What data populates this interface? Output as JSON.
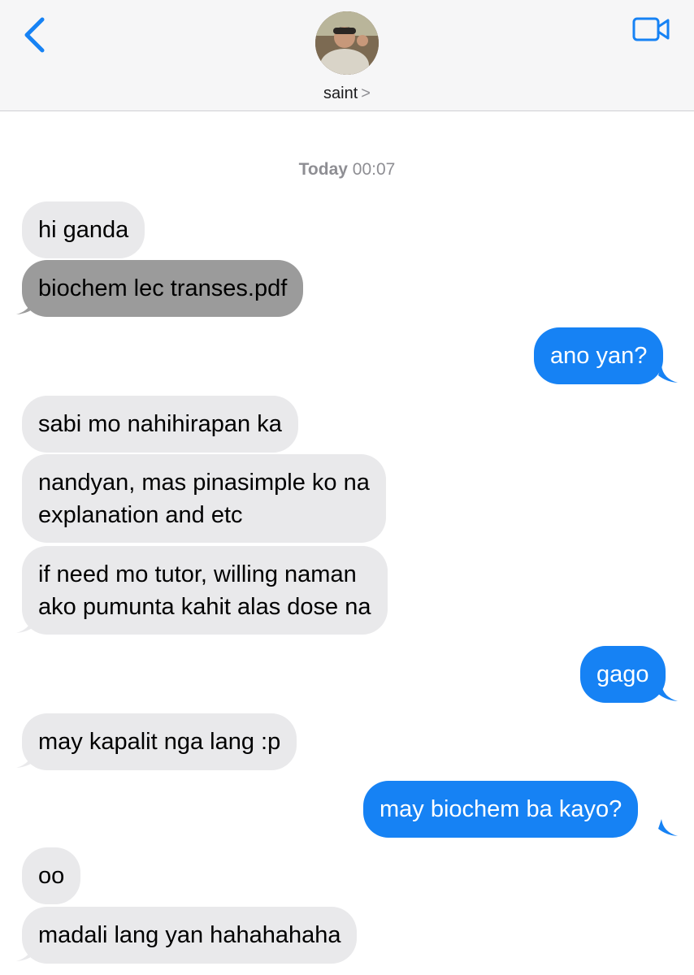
{
  "header": {
    "contact_name": "saint",
    "contact_chevron": ">",
    "back_icon": "chevron-left-icon",
    "video_icon": "video-camera-icon",
    "accent_color": "#1682f4"
  },
  "timestamp": {
    "day": "Today",
    "time": "00:07"
  },
  "messages": [
    {
      "direction": "received",
      "text": "hi ganda"
    },
    {
      "direction": "received",
      "type": "file",
      "text": "biochem lec transes.pdf"
    },
    {
      "direction": "sent",
      "text": "ano yan?"
    },
    {
      "direction": "received",
      "text": "sabi mo nahihirapan ka"
    },
    {
      "direction": "received",
      "lines": [
        "nandyan, mas pinasimple ko na",
        "explanation and etc"
      ]
    },
    {
      "direction": "received",
      "lines": [
        "if need mo tutor, willing naman",
        "ako pumunta kahit alas dose na"
      ]
    },
    {
      "direction": "sent",
      "text": "gago"
    },
    {
      "direction": "received",
      "text": "may kapalit nga lang :p"
    },
    {
      "direction": "sent",
      "text": "may biochem ba kayo?"
    },
    {
      "direction": "received",
      "text": "oo"
    },
    {
      "direction": "received",
      "text": "madali lang yan hahahahaha"
    }
  ],
  "colors": {
    "sent_bubble": "#1682f4",
    "received_bubble": "#e9e9eb",
    "file_bubble": "#9b9b9b"
  }
}
